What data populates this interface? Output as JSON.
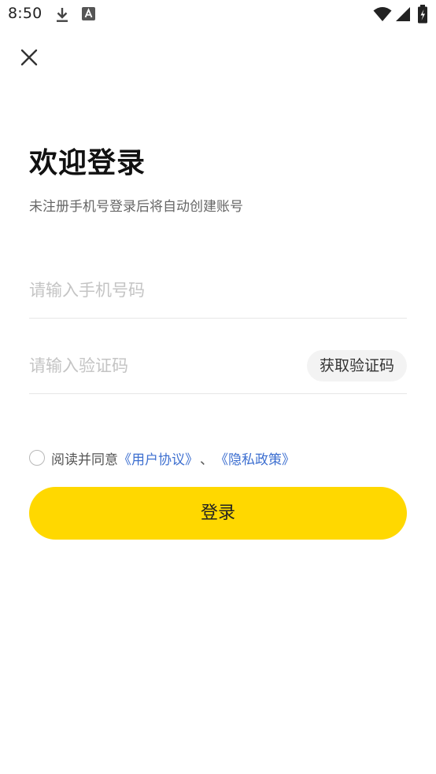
{
  "status_bar": {
    "time": "8:50",
    "icons": [
      "download-icon",
      "a-icon",
      "wifi-icon",
      "signal-icon",
      "battery-icon"
    ]
  },
  "header": {
    "close_icon": "close-icon"
  },
  "login": {
    "title": "欢迎登录",
    "subtitle": "未注册手机号登录后将自动创建账号",
    "phone_placeholder": "请输入手机号码",
    "phone_value": "",
    "code_placeholder": "请输入验证码",
    "code_value": "",
    "get_code_label": "获取验证码",
    "agree_prefix": "阅读并同意",
    "user_agreement": "《用户协议》",
    "separator": "、",
    "privacy_policy": "《隐私政策》",
    "agree_checked": false,
    "submit_label": "登录"
  },
  "colors": {
    "primary_button": "#ffd800",
    "link": "#3d6fd0",
    "placeholder": "#c4c4c4",
    "subtitle": "#666666"
  }
}
